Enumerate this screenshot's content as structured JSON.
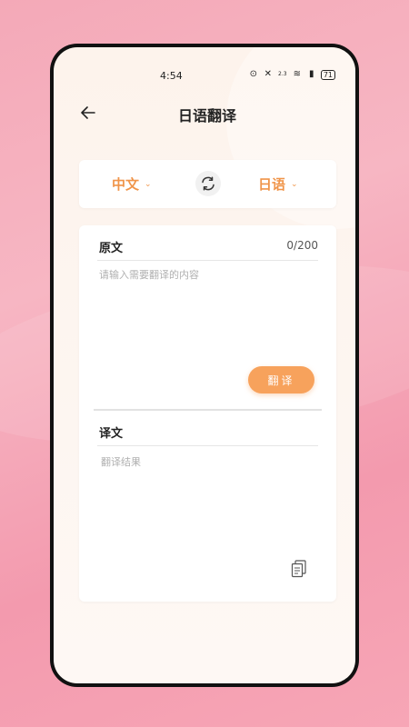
{
  "status_bar": {
    "time": "4:54",
    "network": "2.3",
    "battery": "71"
  },
  "header": {
    "title": "日语翻译"
  },
  "languages": {
    "source": "中文",
    "target": "日语"
  },
  "source": {
    "label": "原文",
    "counter": "0/200",
    "placeholder": "请输入需要翻译的内容",
    "value": ""
  },
  "actions": {
    "translate_label": "翻译"
  },
  "result": {
    "label": "译文",
    "placeholder": "翻译结果"
  },
  "colors": {
    "accent": "#f0954a",
    "button": "#f7a25c",
    "background": "#f4a9b8"
  }
}
